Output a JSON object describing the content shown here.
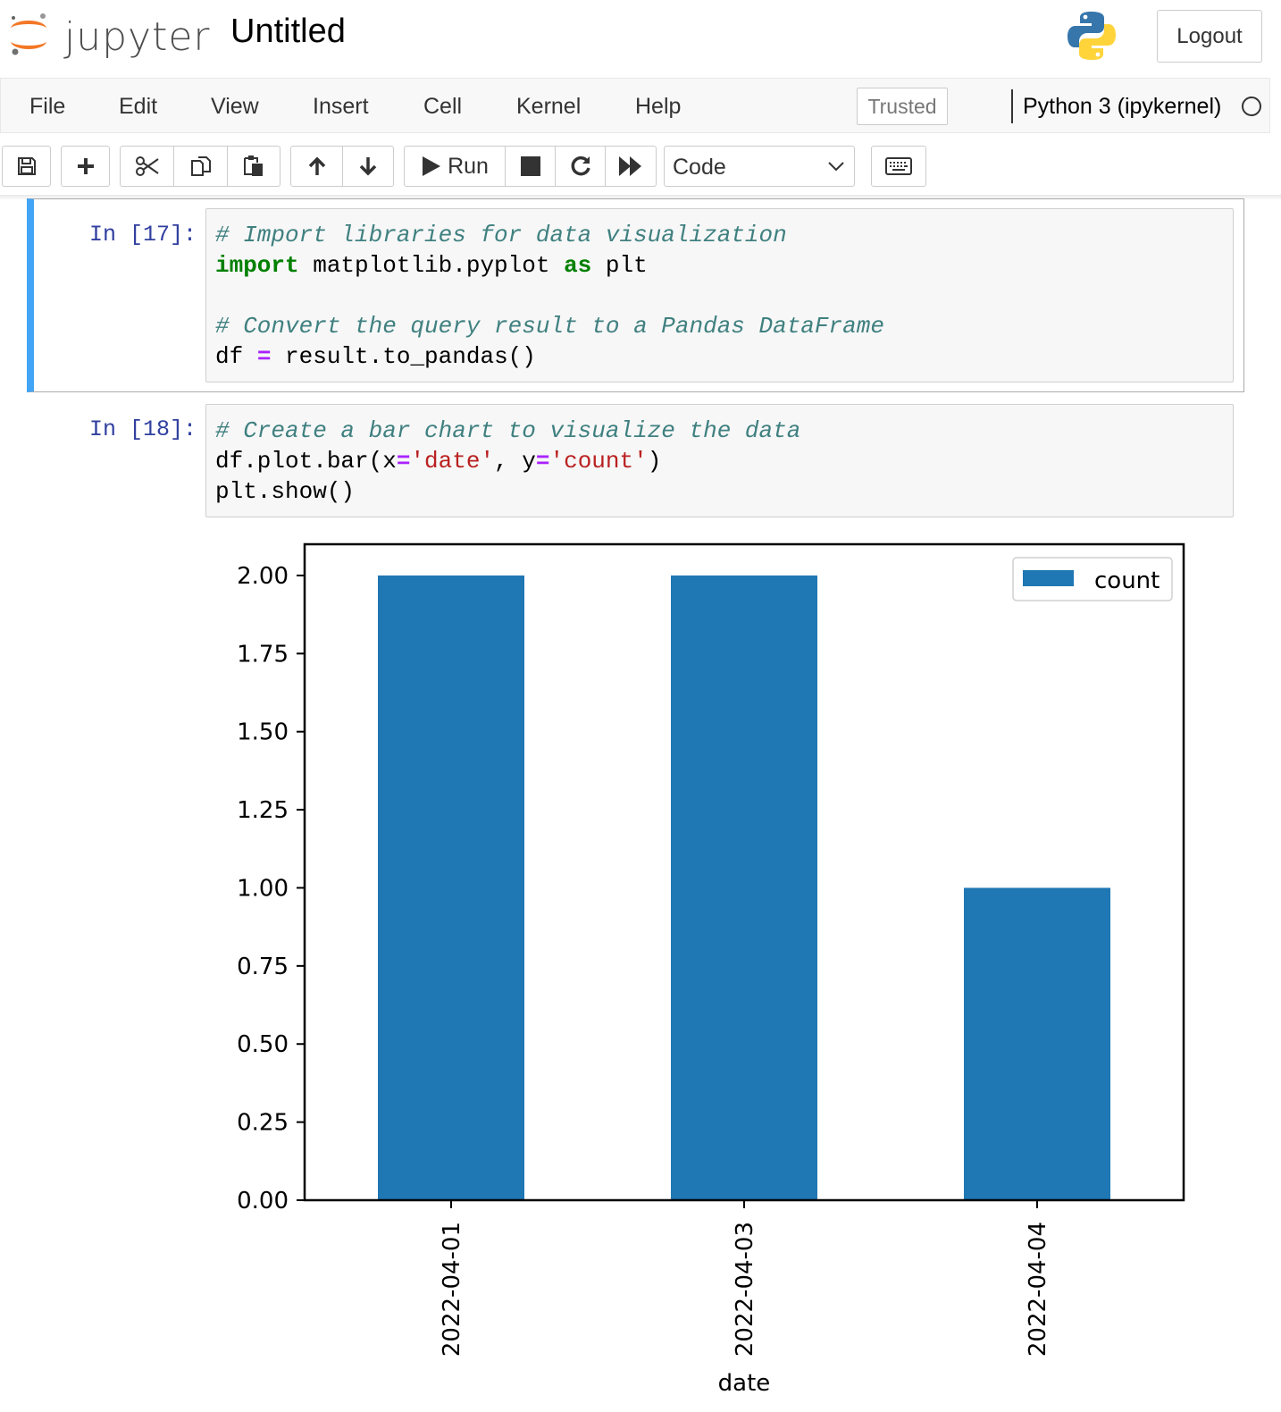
{
  "header": {
    "logo_text": "jupyter",
    "notebook_title": "Untitled",
    "logout_label": "Logout"
  },
  "menubar": {
    "items": [
      "File",
      "Edit",
      "View",
      "Insert",
      "Cell",
      "Kernel",
      "Help"
    ],
    "trusted_label": "Trusted",
    "kernel_name": "Python 3 (ipykernel)"
  },
  "toolbar": {
    "run_label": "Run",
    "cell_type": "Code",
    "icons": [
      "save-icon",
      "plus-icon",
      "cut-icon",
      "copy-icon",
      "paste-icon",
      "arrow-up-icon",
      "arrow-down-icon",
      "play-icon",
      "stop-icon",
      "restart-icon",
      "fast-forward-icon",
      "chevron-down-icon",
      "keyboard-icon"
    ]
  },
  "cells": [
    {
      "prompt": "In [17]:",
      "lines": [
        [
          {
            "t": "# Import libraries for data visualization",
            "c": "comment"
          }
        ],
        [
          {
            "t": "import",
            "c": "keyword"
          },
          {
            "t": " matplotlib.pyplot ",
            "c": ""
          },
          {
            "t": "as",
            "c": "keyword"
          },
          {
            "t": " plt",
            "c": ""
          }
        ],
        [],
        [
          {
            "t": "# Convert the query result to a Pandas DataFrame",
            "c": "comment"
          }
        ],
        [
          {
            "t": "df ",
            "c": ""
          },
          {
            "t": "=",
            "c": "operator"
          },
          {
            "t": " result.to_pandas()",
            "c": ""
          }
        ]
      ]
    },
    {
      "prompt": "In [18]:",
      "lines": [
        [
          {
            "t": "# Create a bar chart to visualize the data",
            "c": "comment"
          }
        ],
        [
          {
            "t": "df.plot.bar(x",
            "c": ""
          },
          {
            "t": "=",
            "c": "operator"
          },
          {
            "t": "'date'",
            "c": "string"
          },
          {
            "t": ", y",
            "c": ""
          },
          {
            "t": "=",
            "c": "operator"
          },
          {
            "t": "'count'",
            "c": "string"
          },
          {
            "t": ")",
            "c": ""
          }
        ],
        [
          {
            "t": "plt.show()",
            "c": ""
          }
        ]
      ]
    }
  ],
  "chart_data": {
    "type": "bar",
    "categories": [
      "2022-04-01",
      "2022-04-03",
      "2022-04-04"
    ],
    "series": [
      {
        "name": "count",
        "values": [
          2,
          2,
          1
        ]
      }
    ],
    "xlabel": "date",
    "ylabel": "",
    "ylim": [
      0,
      2.1
    ],
    "yticks": [
      "0.00",
      "0.25",
      "0.50",
      "0.75",
      "1.00",
      "1.25",
      "1.50",
      "1.75",
      "2.00"
    ],
    "legend": "top-right",
    "grid": false,
    "bar_color": "#1f77b4"
  }
}
